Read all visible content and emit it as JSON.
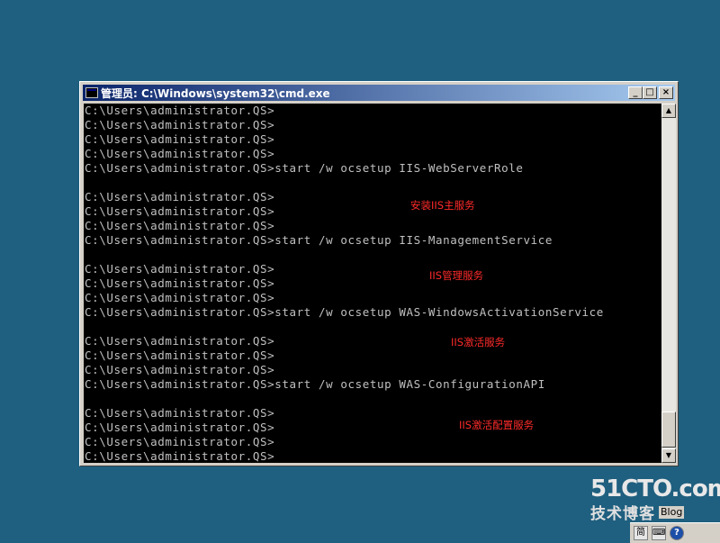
{
  "window": {
    "title": "管理员: C:\\Windows\\system32\\cmd.exe",
    "minimize_label": "_",
    "maximize_label": "□",
    "close_label": "×"
  },
  "console": {
    "lines": [
      "C:\\Users\\administrator.QS>",
      "C:\\Users\\administrator.QS>",
      "C:\\Users\\administrator.QS>",
      "C:\\Users\\administrator.QS>",
      "C:\\Users\\administrator.QS>start /w ocsetup IIS-WebServerRole",
      "",
      "C:\\Users\\administrator.QS>",
      "C:\\Users\\administrator.QS>",
      "C:\\Users\\administrator.QS>",
      "C:\\Users\\administrator.QS>start /w ocsetup IIS-ManagementService",
      "",
      "C:\\Users\\administrator.QS>",
      "C:\\Users\\administrator.QS>",
      "C:\\Users\\administrator.QS>",
      "C:\\Users\\administrator.QS>start /w ocsetup WAS-WindowsActivationService",
      "",
      "C:\\Users\\administrator.QS>",
      "C:\\Users\\administrator.QS>",
      "C:\\Users\\administrator.QS>",
      "C:\\Users\\administrator.QS>start /w ocsetup WAS-ConfigurationAPI",
      "",
      "C:\\Users\\administrator.QS>",
      "C:\\Users\\administrator.QS>",
      "C:\\Users\\administrator.QS>",
      "C:\\Users\\administrator.QS>"
    ],
    "annotations": [
      "安装IIS主服务",
      "IIS管理服务",
      "IIS激活服务",
      "IIS激活配置服务"
    ],
    "annotation_color": "#ff2a2a"
  },
  "scrollbar": {
    "up_arrow": "▲",
    "down_arrow": "▼"
  },
  "watermark": {
    "brand": "51CTO.com",
    "subtitle": "技术博客",
    "blog": "Blog"
  },
  "ime": {
    "lang_label": "简",
    "keyboard_icon": "keyboard-icon",
    "help_label": "?"
  }
}
